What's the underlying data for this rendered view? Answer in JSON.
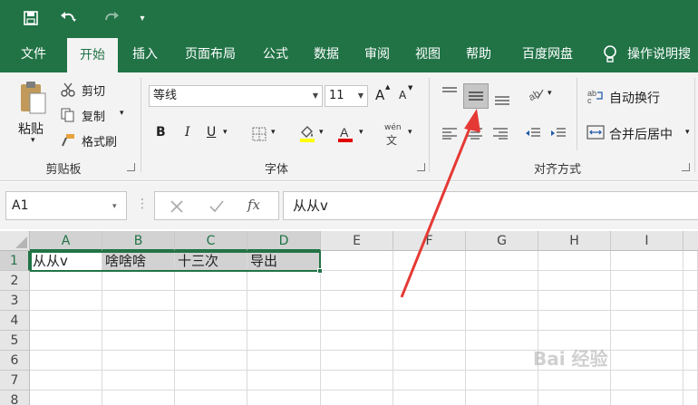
{
  "quick_access": {
    "save_icon": "save-icon",
    "undo_icon": "undo-icon",
    "redo_icon": "redo-icon",
    "customize_icon": "customize-icon"
  },
  "tabs": [
    {
      "label": "文件"
    },
    {
      "label": "开始"
    },
    {
      "label": "插入"
    },
    {
      "label": "页面布局"
    },
    {
      "label": "公式"
    },
    {
      "label": "数据"
    },
    {
      "label": "审阅"
    },
    {
      "label": "视图"
    },
    {
      "label": "帮助"
    },
    {
      "label": "百度网盘"
    }
  ],
  "tell_me": "操作说明搜",
  "clipboard": {
    "paste": "粘贴",
    "cut": "剪切",
    "copy": "复制",
    "format_painter": "格式刷",
    "group_title": "剪贴板"
  },
  "font": {
    "name": "等线",
    "size": "11",
    "group_title": "字体",
    "bold": "B",
    "italic": "I",
    "underline": "U",
    "increase": "A",
    "decrease": "A",
    "phonetic": "wén"
  },
  "alignment": {
    "wrap_text": "自动换行",
    "merge_center": "合并后居中",
    "group_title": "对齐方式"
  },
  "right_cut_label": "剪贴板",
  "formula_bar": {
    "name_box": "A1",
    "formula": "从从v",
    "fx": "fx"
  },
  "columns": [
    "A",
    "B",
    "C",
    "D",
    "E",
    "F",
    "G",
    "H",
    "I"
  ],
  "rows": [
    "1",
    "2",
    "3",
    "4",
    "5",
    "6",
    "7",
    "8"
  ],
  "row1": [
    "从从v",
    "啥啥啥",
    "十三次",
    "导出"
  ],
  "watermark": "Bai 经验",
  "colors": {
    "excel_green": "#217346",
    "arrow_red": "#e53935"
  }
}
